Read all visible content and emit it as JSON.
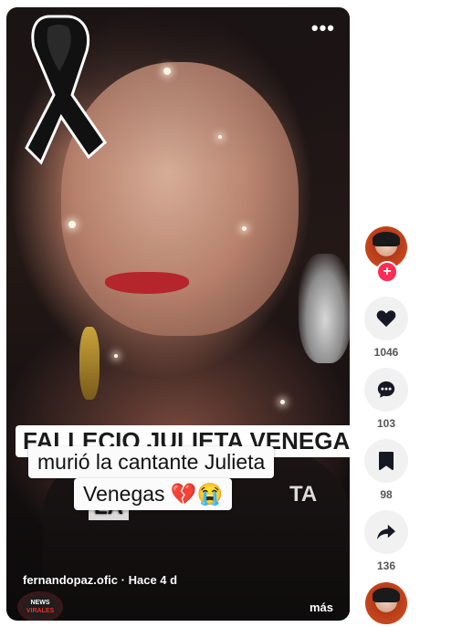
{
  "video": {
    "caption_background": "FALLECIO JULIETA VENEGAS",
    "caption_main_line1": "murió la cantante Julieta",
    "caption_main_line2": "Venegas",
    "caption_emoji": "💔😭",
    "caption_partial_left": "LA",
    "caption_partial_right": "TA",
    "author": "fernandopaz.ofic",
    "separator": "·",
    "time_ago": "Hace 4 d",
    "more_label": "más",
    "logo_line1": "NEWS",
    "logo_line2": "VIRALES"
  },
  "actions": {
    "follow_label": "+",
    "likes": "1046",
    "comments": "103",
    "saves": "98",
    "shares": "136"
  },
  "colors": {
    "follow": "#fe2c55",
    "action_bg": "#f1f1f2",
    "count_text": "#555555"
  },
  "icons": [
    "black-ribbon-icon",
    "more-options-icon",
    "heart-icon",
    "comment-icon",
    "bookmark-icon",
    "share-icon"
  ]
}
